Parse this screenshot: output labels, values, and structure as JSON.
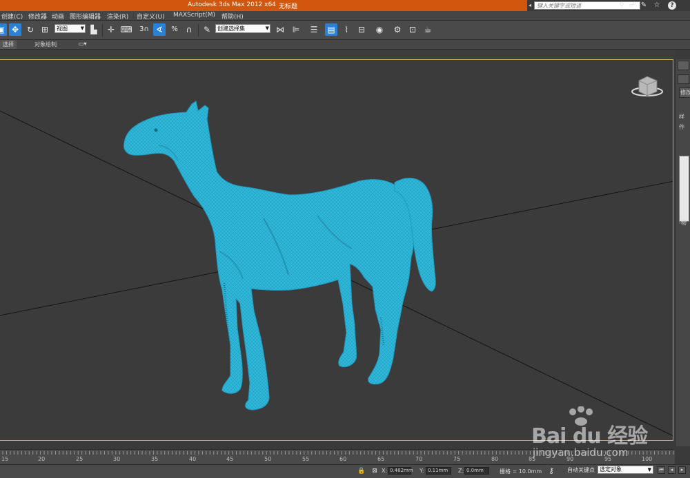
{
  "titlebar": {
    "app_title": "Autodesk 3ds Max  2012 x64",
    "doc_title": "无标题",
    "search_placeholder": "键入关键字或短语",
    "icons": [
      "binoculars-icon",
      "community-icon",
      "tools-icon",
      "star-icon",
      "help-icon"
    ],
    "help_glyph": "?"
  },
  "menubar": {
    "items": [
      "创建(C)",
      "修改器",
      "动画",
      "图形编辑器",
      "渲染(R)",
      "自定义(U)",
      "MAXScript(M)",
      "帮助(H)"
    ]
  },
  "toolbar": {
    "view_select": "视图",
    "snap_label": "3",
    "selection_set": "创建选择集"
  },
  "ribbon": {
    "tabs": [
      "选择",
      "对象绘制"
    ]
  },
  "viewport": {
    "model": "horse-mesh",
    "mesh_color": "#2fb7d9",
    "border_color": "#c8b04a"
  },
  "command_panel": {
    "label_modify": "修改",
    "label_a": "样",
    "label_b": "作",
    "label_c": "-物"
  },
  "timeline": {
    "ticks": [
      "15",
      "20",
      "25",
      "30",
      "35",
      "40",
      "45",
      "50",
      "55",
      "60",
      "65",
      "70",
      "75",
      "80",
      "85",
      "90",
      "95",
      "100"
    ]
  },
  "status": {
    "x_label": "X:",
    "x_value": "0.482mm",
    "y_label": "Y:",
    "y_value": "0.11mm",
    "z_label": "Z:",
    "z_value": "0.0mm",
    "grid": "栅格 = 10.0mm",
    "autokey": "自动关键点",
    "autokey_target": "选定对象"
  },
  "watermark": {
    "brand": "Bai du 经验",
    "url": "jingyan.baidu.com"
  }
}
